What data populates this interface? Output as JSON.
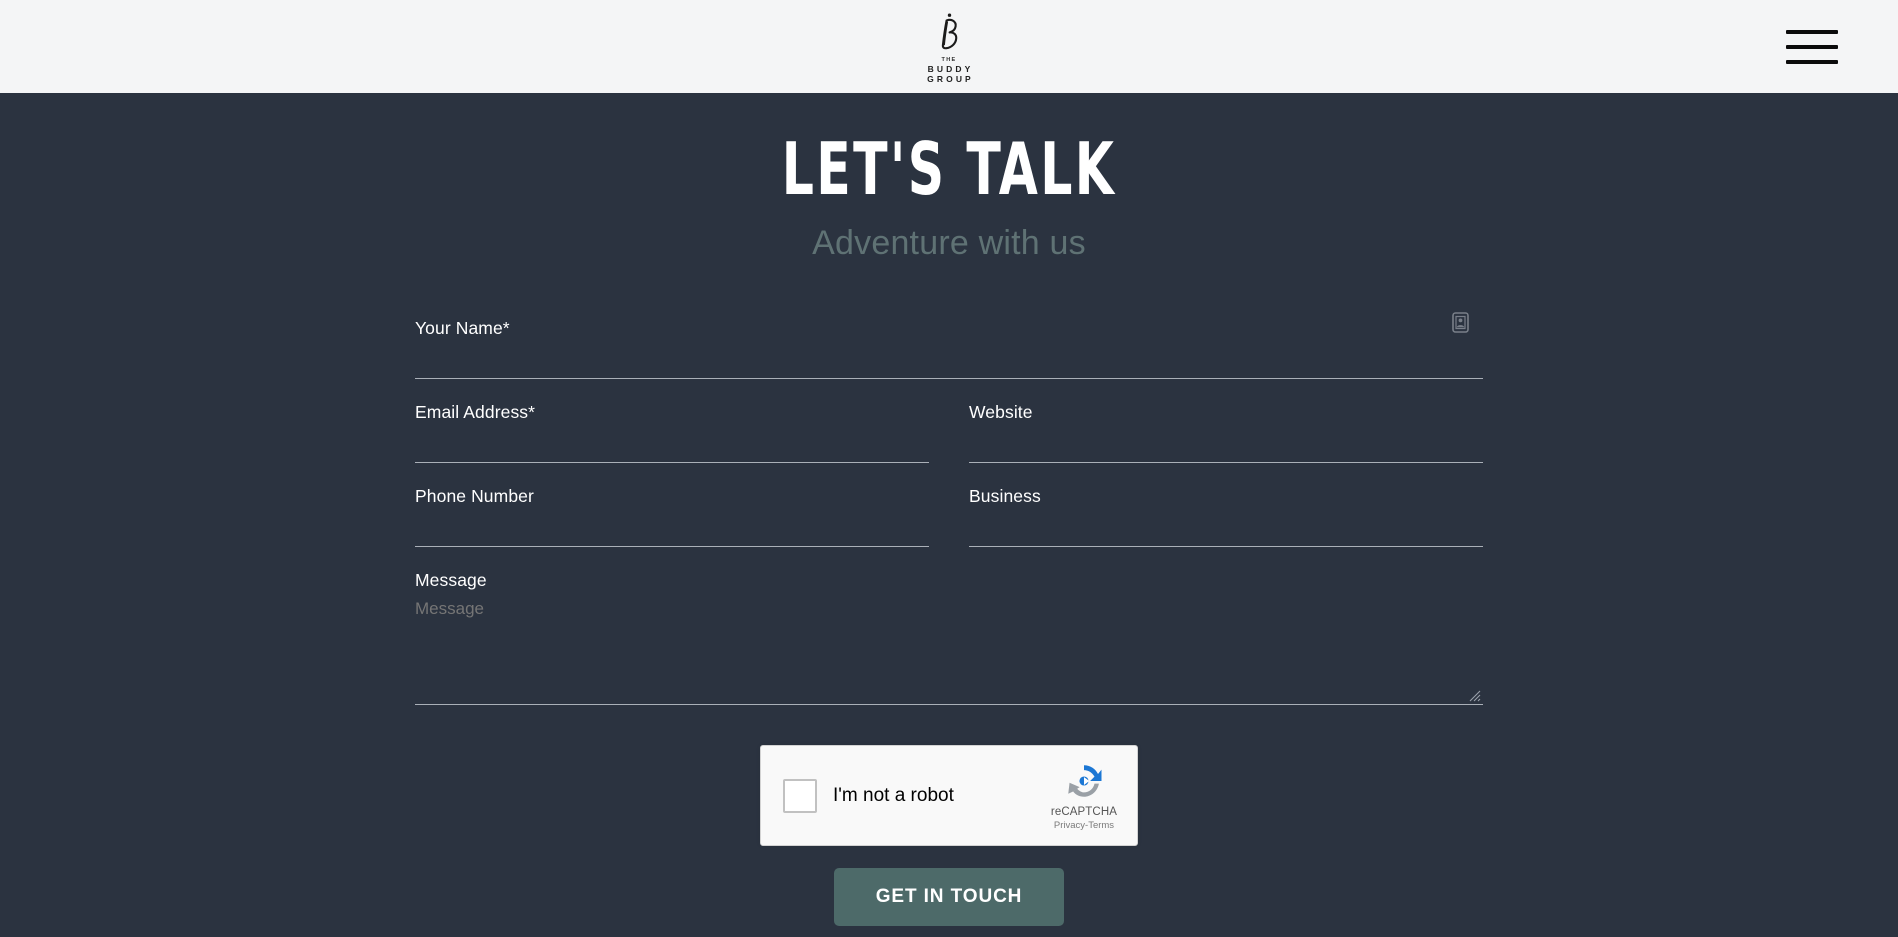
{
  "header": {
    "logo": {
      "mark_alt": "stylized-b-monogram",
      "the": "THE",
      "name_line1": "BUDDY",
      "name_line2": "GROUP"
    },
    "menu_label": "Menu",
    "background_color": "#f4f5f6"
  },
  "hero": {
    "title": "LET'S TALK",
    "subtitle": "Adventure with us",
    "title_color": "#ffffff",
    "subtitle_color": "#5f7274",
    "background_color": "#2b3340"
  },
  "form": {
    "fields": {
      "name": {
        "label": "Your Name*",
        "value": "",
        "placeholder": "Your Name*"
      },
      "email": {
        "label": "Email Address*",
        "value": "",
        "placeholder": "Email Address*"
      },
      "website": {
        "label": "Website",
        "value": "",
        "placeholder": "Website"
      },
      "phone": {
        "label": "Phone Number",
        "value": "",
        "placeholder": "Phone Number"
      },
      "business": {
        "label": "Business",
        "value": "",
        "placeholder": "Business"
      },
      "message": {
        "label": "Message",
        "value": "",
        "placeholder": "Message"
      }
    },
    "underline_color": "#aab0b8"
  },
  "captcha": {
    "checkbox_label": "I'm not a robot",
    "brand": "reCAPTCHA",
    "privacy": "Privacy",
    "separator": "-",
    "terms": "Terms",
    "logo_blue": "#1c77d4",
    "logo_grey": "#9aa0a6",
    "background_color": "#f9f9f9"
  },
  "submit": {
    "label": "GET IN TOUCH",
    "background_color": "#4d6a69",
    "text_color": "#ffffff"
  }
}
